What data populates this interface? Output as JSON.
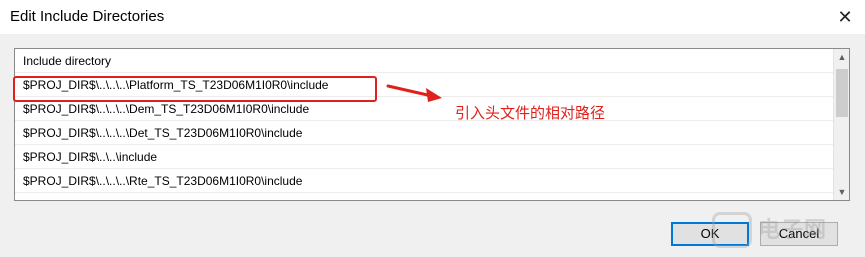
{
  "dialog": {
    "title": "Edit Include Directories",
    "close_glyph": "✕"
  },
  "list": {
    "header": "Include directory",
    "rows": [
      "$PROJ_DIR$\\..\\..\\..\\Platform_TS_T23D06M1I0R0\\include",
      "$PROJ_DIR$\\..\\..\\..\\Dem_TS_T23D06M1I0R0\\include",
      "$PROJ_DIR$\\..\\..\\..\\Det_TS_T23D06M1I0R0\\include",
      "$PROJ_DIR$\\..\\..\\include",
      "$PROJ_DIR$\\..\\..\\..\\Rte_TS_T23D06M1I0R0\\include"
    ],
    "scroll_up_glyph": "▲",
    "scroll_down_glyph": "▼"
  },
  "annotation": {
    "text": "引入头文件的相对路径",
    "color": "#e0201b"
  },
  "buttons": {
    "ok": "OK",
    "cancel": "Cancel"
  },
  "watermark": {
    "text": "电子网"
  },
  "icons": {
    "close": "close-icon",
    "scroll_up": "chevron-up-icon",
    "scroll_down": "chevron-down-icon",
    "arrow": "arrow-right-icon"
  }
}
